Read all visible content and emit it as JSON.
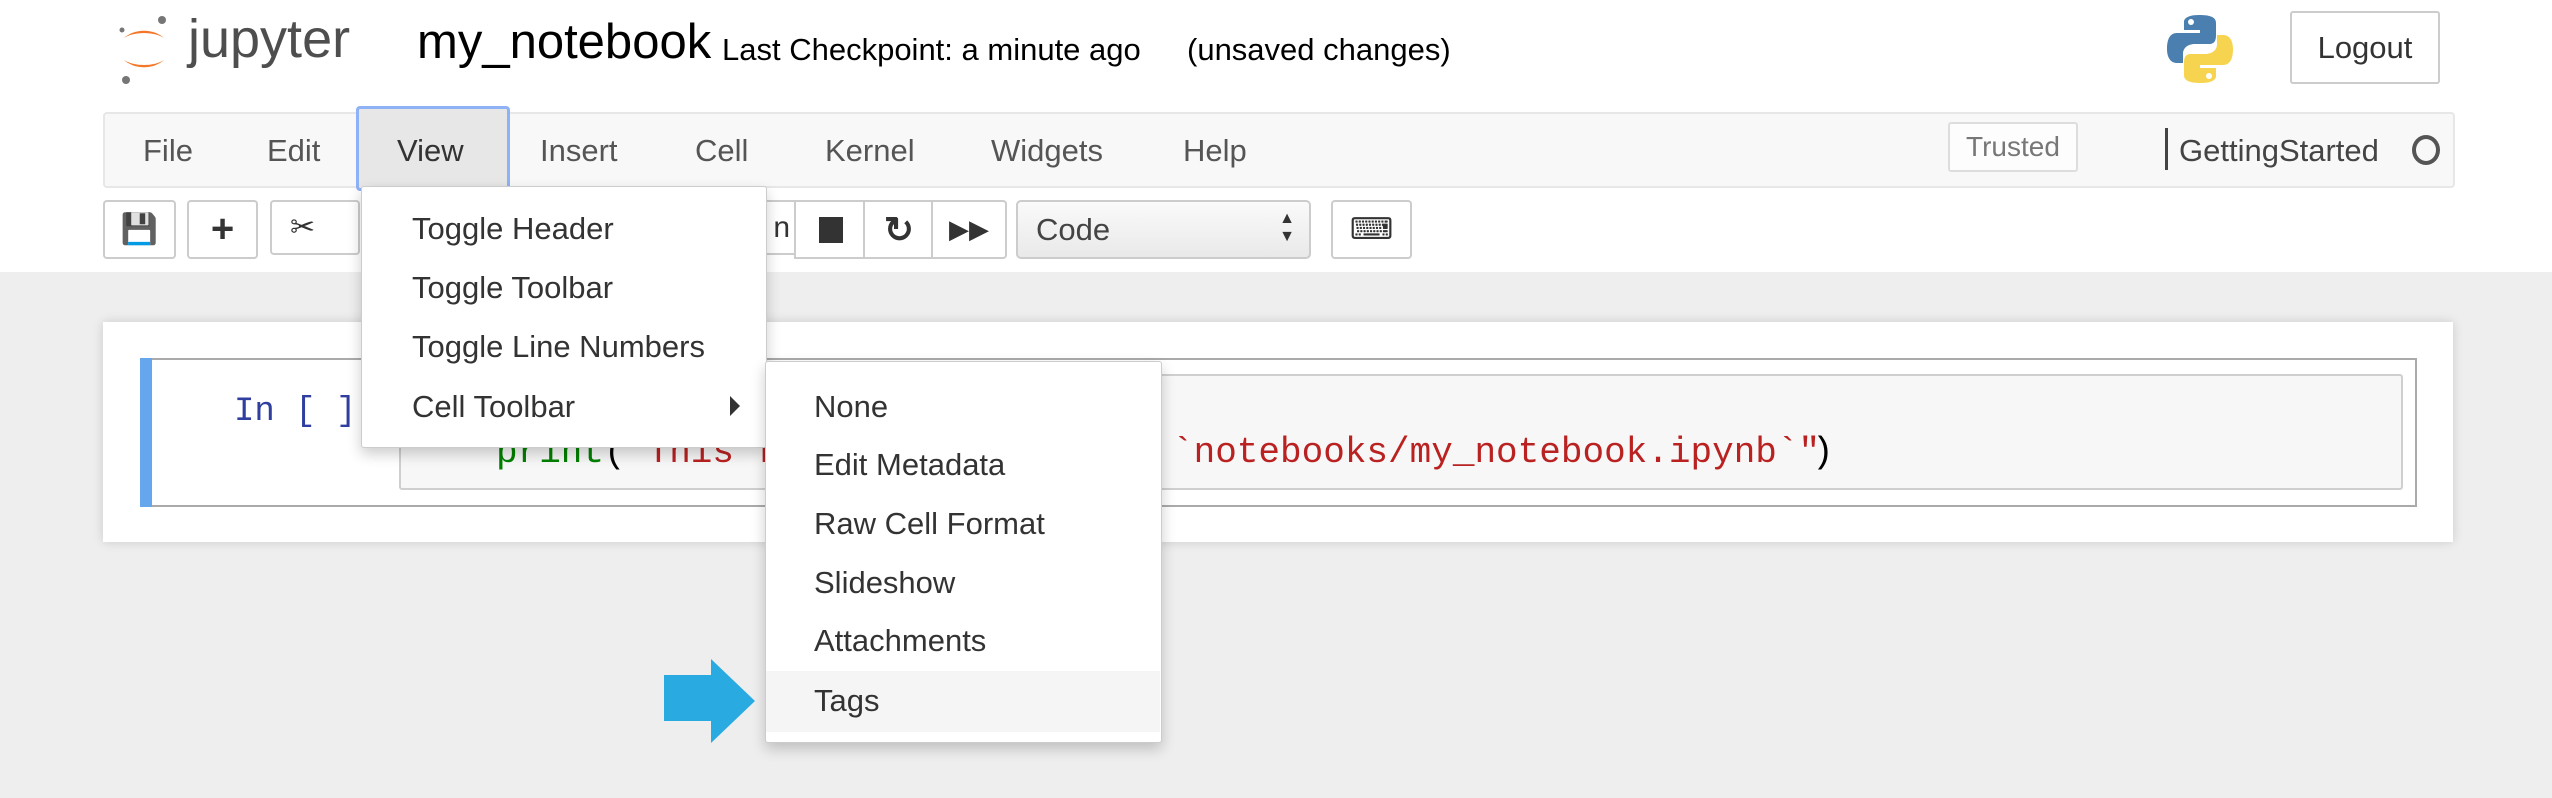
{
  "header": {
    "logo_text": "jupyter",
    "notebook_name": "my_notebook",
    "checkpoint": "Last Checkpoint: a minute ago",
    "unsaved": "(unsaved changes)",
    "logout": "Logout"
  },
  "menubar": {
    "items": [
      "File",
      "Edit",
      "View",
      "Insert",
      "Cell",
      "Kernel",
      "Widgets",
      "Help"
    ],
    "active": "View",
    "trusted": "Trusted",
    "kernel_name": "GettingStarted"
  },
  "toolbar": {
    "run_partial": "n",
    "cell_type": "Code"
  },
  "cell": {
    "prompt": "In [ ]:",
    "code_visible_start_fn": "print",
    "code_visible_start_paren": "(",
    "code_visible_start_str": "\"This f",
    "code_visible_end_str": "`notebooks/my_notebook.ipynb`\"",
    "code_visible_end_paren": ")"
  },
  "view_menu": {
    "items": [
      "Toggle Header",
      "Toggle Toolbar",
      "Toggle Line Numbers",
      "Cell Toolbar"
    ]
  },
  "cell_toolbar_submenu": {
    "items": [
      "None",
      "Edit Metadata",
      "Raw Cell Format",
      "Slideshow",
      "Attachments",
      "Tags"
    ],
    "highlighted": "Tags"
  },
  "colors": {
    "accent_arrow": "#29ABE2",
    "cell_selected_bar": "#66A6ED",
    "jupyter_orange": "#F37726",
    "code_keyword": "#008000",
    "code_string": "#BA2121"
  }
}
